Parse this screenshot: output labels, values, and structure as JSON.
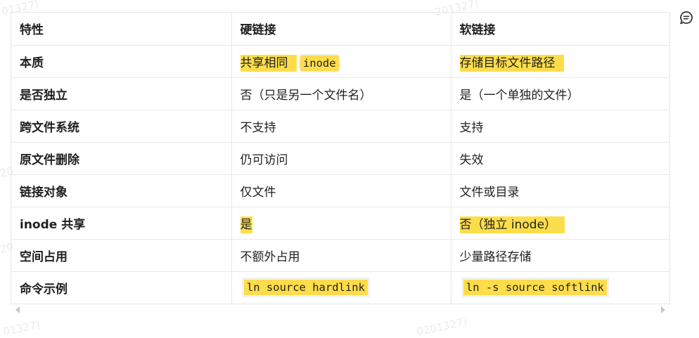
{
  "watermarks": [
    "01327)",
    "201327)",
    "20",
    "20",
    "01327)",
    "0201327)"
  ],
  "table": {
    "headers": [
      "特性",
      "硬链接",
      "软链接"
    ],
    "rows": [
      {
        "feature": "本质",
        "hard": "共享相同",
        "hard_code": "inode",
        "soft": "存储目标文件路径"
      },
      {
        "feature": "是否独立",
        "hard": "否（只是另一个文件名）",
        "soft": "是（一个单独的文件）"
      },
      {
        "feature": "跨文件系统",
        "hard": "不支持",
        "soft": "支持"
      },
      {
        "feature": "原文件删除",
        "hard": "仍可访问",
        "soft": "失效"
      },
      {
        "feature": "链接对象",
        "hard": "仅文件",
        "soft": "文件或目录"
      },
      {
        "feature": "inode 共享",
        "hard": "是",
        "soft": "否（独立 inode）"
      },
      {
        "feature": "空间占用",
        "hard": "不额外占用",
        "soft": "少量路径存储"
      },
      {
        "feature": "命令示例",
        "hard": "ln source hardlink",
        "soft": "ln -s source softlink"
      }
    ]
  },
  "colors": {
    "highlight": "#fddd4a",
    "border": "#e8e8e8"
  },
  "icons": {
    "comment": "comment-icon",
    "scroll_left": "scroll-left-arrow",
    "scroll_right": "scroll-right-arrow"
  }
}
